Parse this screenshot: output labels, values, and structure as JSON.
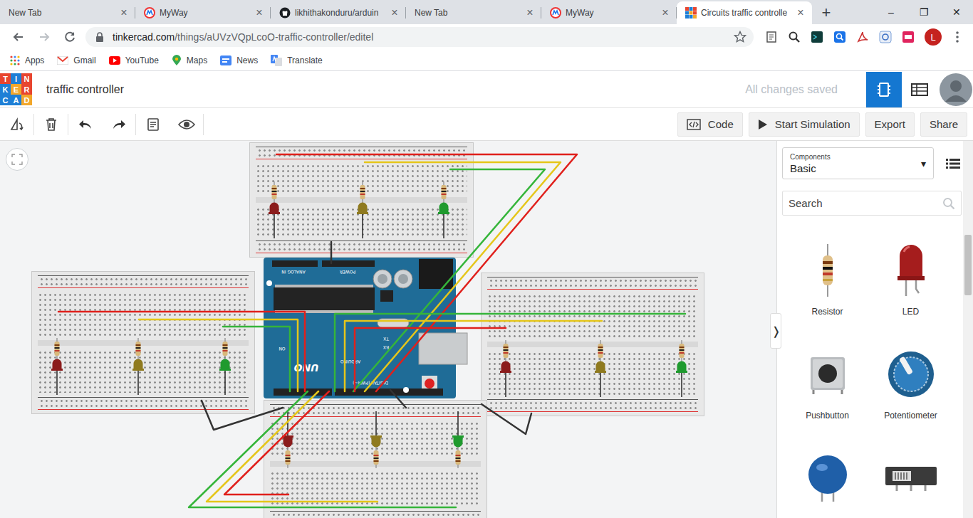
{
  "browser": {
    "tabs": [
      {
        "label": "New Tab",
        "kind": "plain",
        "selected": false
      },
      {
        "label": "MyWay",
        "kind": "myway",
        "selected": false
      },
      {
        "label": "likhithakonduru/arduin",
        "kind": "github",
        "selected": false
      },
      {
        "label": "New Tab",
        "kind": "plain",
        "selected": false
      },
      {
        "label": "MyWay",
        "kind": "myway",
        "selected": false
      },
      {
        "label": "Circuits traffic controlle",
        "kind": "tinkercad",
        "selected": true
      }
    ],
    "tab_close": "×",
    "new_tab": "+",
    "window_controls": [
      "–",
      "❐",
      "✕"
    ],
    "address": {
      "host": "tinkercad.com",
      "path": "/things/aUVzVQpLcoO-traffic-controller/editel"
    },
    "profile_initial": "L",
    "bookmarks": [
      {
        "label": "Apps",
        "kind": "apps"
      },
      {
        "label": "Gmail",
        "kind": "gmail"
      },
      {
        "label": "YouTube",
        "kind": "youtube"
      },
      {
        "label": "Maps",
        "kind": "maps"
      },
      {
        "label": "News",
        "kind": "news"
      },
      {
        "label": "Translate",
        "kind": "translate"
      }
    ]
  },
  "app": {
    "logo": [
      {
        "letter": "T",
        "color": "#e8452f"
      },
      {
        "letter": "I",
        "color": "#1e7fd6"
      },
      {
        "letter": "N",
        "color": "#e8452f"
      },
      {
        "letter": "K",
        "color": "#1e7fd6"
      },
      {
        "letter": "E",
        "color": "#f2a72b"
      },
      {
        "letter": "R",
        "color": "#e8452f"
      },
      {
        "letter": "C",
        "color": "#1e7fd6"
      },
      {
        "letter": "A",
        "color": "#1e7fd6"
      },
      {
        "letter": "D",
        "color": "#f2a72b"
      }
    ],
    "title": "traffic controller",
    "save_status": "All changes saved",
    "views": [
      {
        "kind": "circuit",
        "selected": true
      },
      {
        "kind": "list",
        "selected": false
      }
    ],
    "actions": [
      {
        "label": "Code",
        "kind": "code"
      },
      {
        "label": "Start Simulation",
        "kind": "play"
      },
      {
        "label": "Export",
        "kind": "text"
      },
      {
        "label": "Share",
        "kind": "text"
      }
    ]
  },
  "panel": {
    "caption": "Components",
    "value": "Basic",
    "caret": "▾",
    "collapse_toggle": "❭",
    "search_placeholder": "Search",
    "components": [
      {
        "label": "Resistor",
        "kind": "resistor"
      },
      {
        "label": "LED",
        "kind": "led"
      },
      {
        "label": "Pushbutton",
        "kind": "pushbutton"
      },
      {
        "label": "Potentiometer",
        "kind": "potentiometer"
      },
      {
        "kind": "capacitor"
      },
      {
        "kind": "slideswitch"
      }
    ]
  },
  "circuit": {
    "breadboards": [
      {
        "leds": [
          {
            "color": "#8b1c1c"
          },
          {
            "color": "#8f7a1f"
          },
          {
            "color": "#1f9a2e"
          }
        ]
      },
      {
        "leds": [
          {
            "color": "#8b1c1c"
          },
          {
            "color": "#8f7a1f"
          },
          {
            "color": "#1f9a2e"
          }
        ]
      },
      {
        "leds": [
          {
            "color": "#8b1c1c"
          },
          {
            "color": "#8f7a1f"
          },
          {
            "color": "#1f9a2e"
          }
        ]
      },
      {
        "leds": [
          {
            "color": "#8b1c1c"
          },
          {
            "color": "#8f7a1f"
          },
          {
            "color": "#1f9a2e"
          }
        ]
      }
    ],
    "arduino": {
      "analog": "ANALOG IN",
      "power": "POWER",
      "model": "UNO",
      "brand": "ARDUINO",
      "digital": "DIGITAL (PWM~)",
      "on": "ON",
      "tx": "TX",
      "rx": "RX"
    },
    "wires": [
      {
        "color": "#e0201c"
      },
      {
        "color": "#e5c61a"
      },
      {
        "color": "#35b53a"
      },
      {
        "color": "#e0201c"
      },
      {
        "color": "#e5c61a"
      },
      {
        "color": "#35b53a"
      },
      {
        "color": "#35b53a"
      },
      {
        "color": "#e5c61a"
      },
      {
        "color": "#e0201c"
      },
      {
        "color": "#e0201c"
      },
      {
        "color": "#e5c61a"
      },
      {
        "color": "#35b53a"
      },
      {
        "color": "#333333"
      },
      {
        "color": "#333333"
      },
      {
        "color": "#333333"
      },
      {
        "color": "#333333"
      }
    ]
  }
}
